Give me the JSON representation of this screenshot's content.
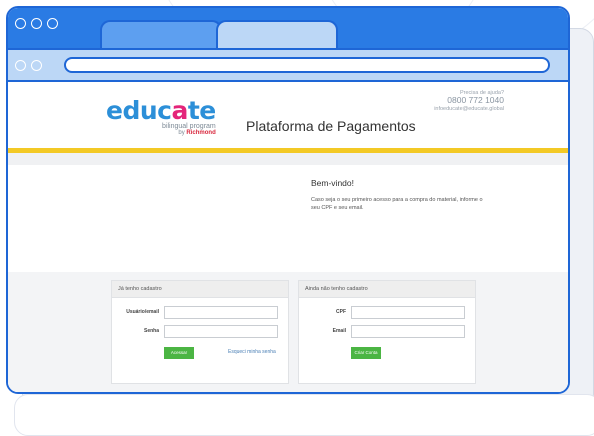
{
  "header": {
    "logo_main_a": "educ",
    "logo_main_b": "a",
    "logo_main_c": "te",
    "logo_sub": "bilingual program",
    "logo_by": "by",
    "logo_brand": "Richmond",
    "title": "Plataforma de Pagamentos",
    "help_question": "Precisa de ajuda?",
    "help_phone": "0800 772 1040",
    "help_email": "infoeducate@educate.global"
  },
  "welcome": {
    "heading": "Bem-vindo!",
    "text": "Caso seja o seu primeiro acesso para a compra do material, informe o seu CPF e seu email."
  },
  "login_panel": {
    "heading": "Já tenho cadastro",
    "user_label": "Usuário/email",
    "user_value": "",
    "password_label": "Senha",
    "password_value": "",
    "submit_label": "Acessar",
    "forgot_label": "Esqueci minha senha"
  },
  "register_panel": {
    "heading": "Ainda não tenho cadastro",
    "cpf_label": "CPF",
    "cpf_value": "",
    "email_label": "Email",
    "email_value": "",
    "submit_label": "Criar Conta"
  },
  "colors": {
    "browser_blue": "#2a7be4",
    "address_blue": "#bcd7f6",
    "accent_yellow": "#f3c925",
    "button_green": "#4bb543",
    "logo_blue": "#2c8fd8",
    "logo_pink": "#e4257a"
  }
}
